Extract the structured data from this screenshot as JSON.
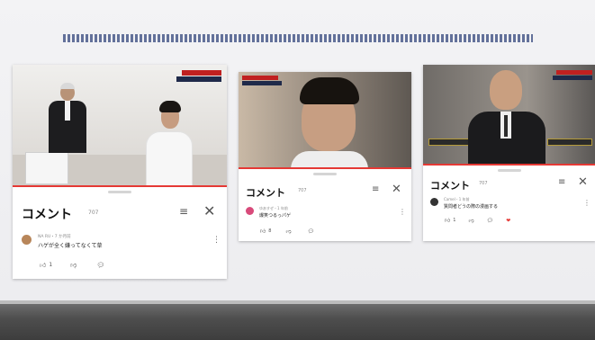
{
  "panels": [
    {
      "comment_title": "コメント",
      "comment_count": "707",
      "comment_meta": "NA RU・7 か月前",
      "comment_text": "ハゲが全く嫌ってなくて草",
      "like_count": "1",
      "avatar_color": "#b8865a"
    },
    {
      "comment_title": "コメント",
      "comment_count": "707",
      "comment_meta": "ゆあすぜ・1 年前",
      "comment_text": "爆笑つるっパゲ",
      "like_count": "8",
      "avatar_color": "#d84a7a"
    },
    {
      "comment_title": "コメント",
      "comment_count": "707",
      "comment_meta": "Camel・1 年前",
      "comment_text": "質問者どうの際の漫画する",
      "like_count": "1",
      "avatar_color": "#333333"
    }
  ],
  "colors": {
    "accent_red": "#e53935",
    "pattern_blue": "#4a5a8a"
  }
}
